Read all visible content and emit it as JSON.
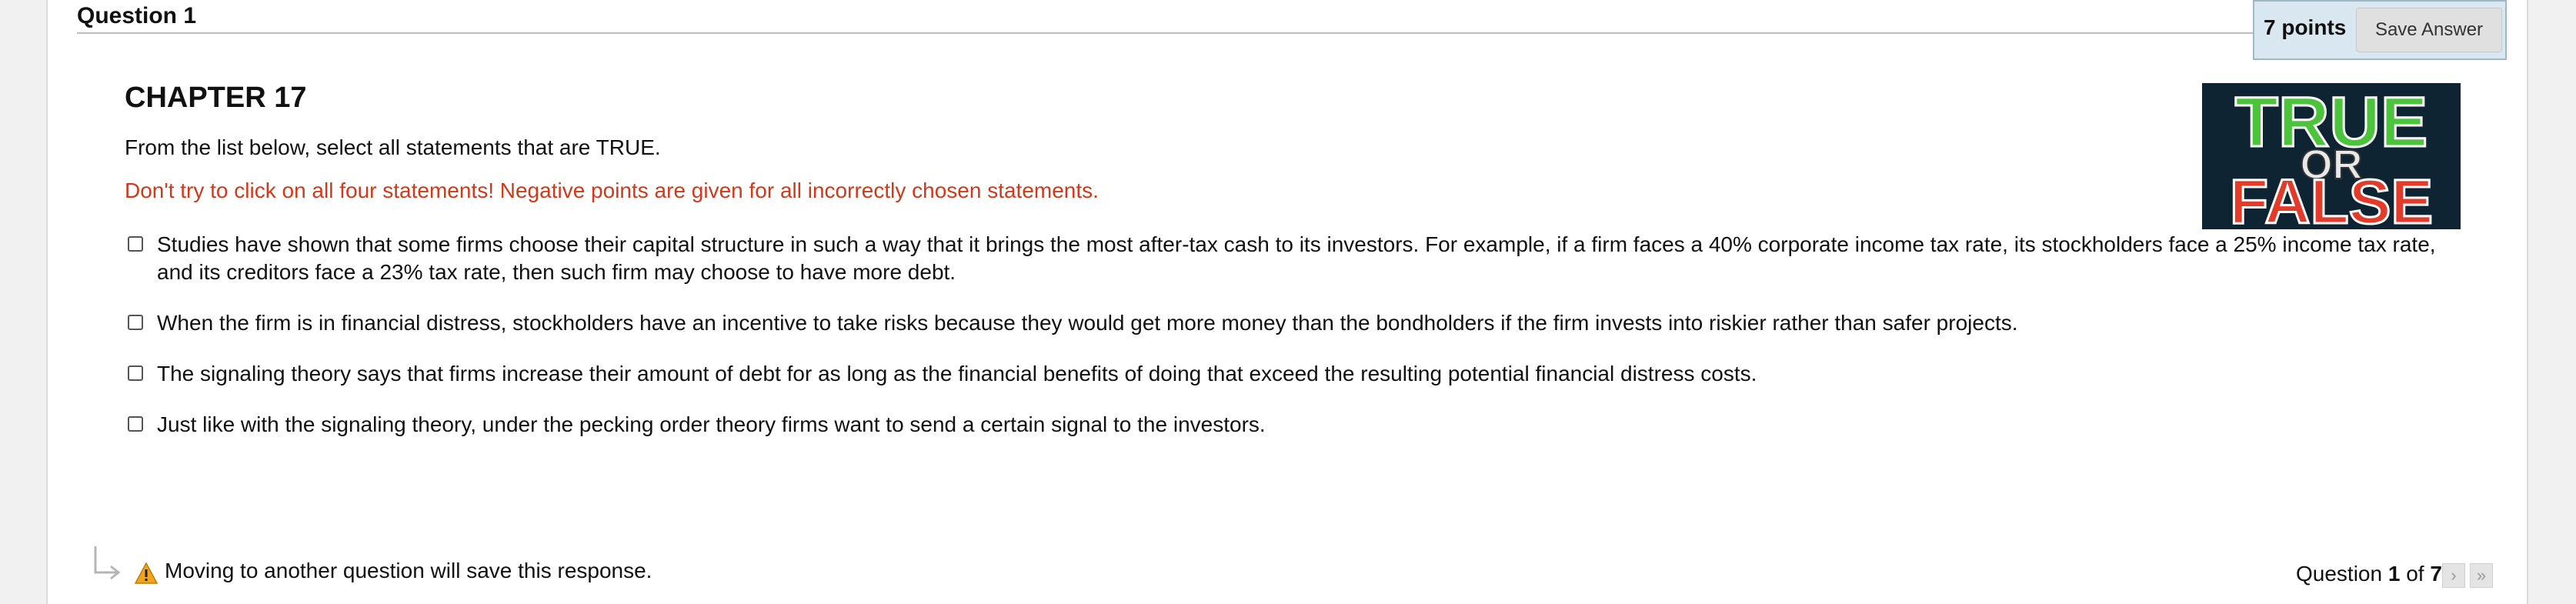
{
  "question": {
    "title": "Question 1",
    "points": "7 points",
    "save_label": "Save Answer"
  },
  "content": {
    "chapter": "CHAPTER 17",
    "instruction": "From the list below, select all statements that are TRUE.",
    "warning": "Don't try to click on all four statements! Negative points are given for all incorrectly chosen statements.",
    "image_words": {
      "top": "TRUE",
      "middle": "OR",
      "bottom": "FALSE"
    }
  },
  "statements": [
    {
      "text": "Studies have shown that some firms choose their capital structure in such a way that it brings the most after-tax cash to its investors. For example, if a firm faces a 40% corporate income tax rate, its stockholders face a 25% income tax rate, and its creditors face a 23% tax rate, then such firm may choose to have more debt.",
      "checked": false
    },
    {
      "text": "When the firm is in financial distress, stockholders have an incentive to take risks because they would get more money than the bondholders if the firm invests into riskier rather than safer projects.",
      "checked": false
    },
    {
      "text": "The signaling theory says that firms increase their amount of debt for as long as the financial benefits of doing that exceed the resulting potential financial distress costs.",
      "checked": false
    },
    {
      "text": "Just like with the signaling theory, under the pecking order theory firms want to send a certain signal to the investors.",
      "checked": false
    }
  ],
  "footer": {
    "save_note": "Moving to another question will save this response.",
    "nav_prefix": "Question ",
    "nav_current": "1",
    "nav_of": " of ",
    "nav_total": "7",
    "next_symbol": "›",
    "last_symbol": "»"
  },
  "colors": {
    "warning_text": "#d2391a",
    "points_bg": "#d9e8f0",
    "true_green": "#4bc43c",
    "false_red": "#e33a2a"
  }
}
